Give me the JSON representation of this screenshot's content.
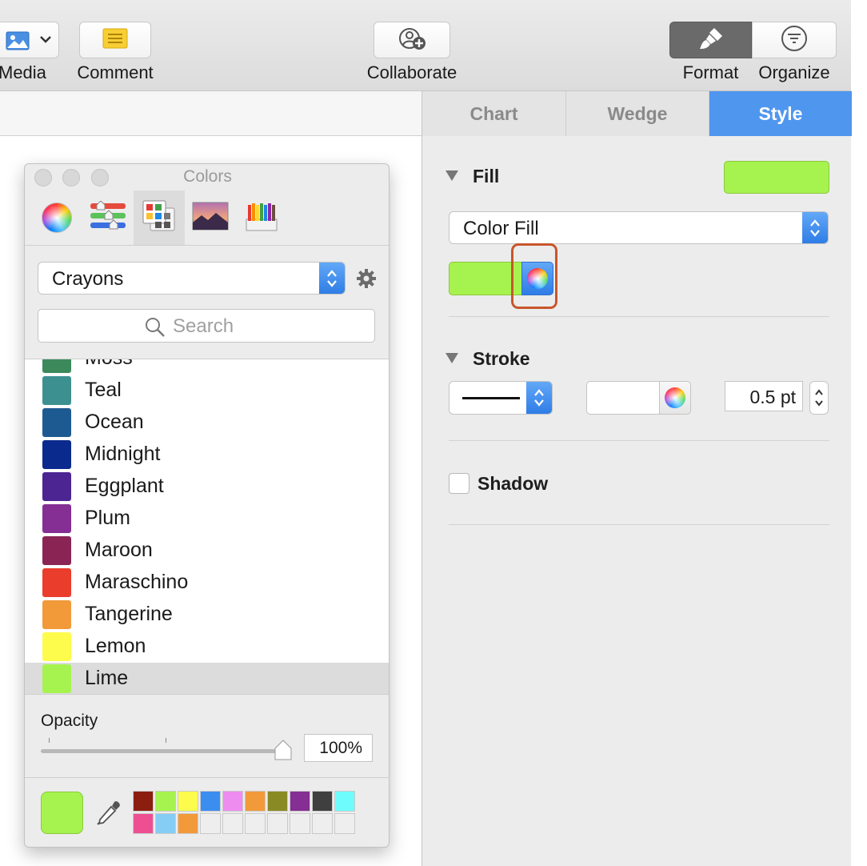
{
  "toolbar": {
    "media_label": "Media",
    "comment_label": "Comment",
    "collaborate_label": "Collaborate",
    "format_label": "Format",
    "organize_label": "Organize"
  },
  "inspector": {
    "tabs": [
      {
        "label": "Chart",
        "active": false
      },
      {
        "label": "Wedge",
        "active": false
      },
      {
        "label": "Style",
        "active": true
      }
    ],
    "fill": {
      "section_label": "Fill",
      "color": "#a6f34f",
      "type_value": "Color Fill"
    },
    "stroke": {
      "section_label": "Stroke",
      "width_value": "0.5 pt"
    },
    "shadow": {
      "label": "Shadow",
      "checked": false
    },
    "highlight_color": "#c8562a",
    "accent_color": "#4f96ef"
  },
  "colors_panel": {
    "title": "Colors",
    "palette_value": "Crayons",
    "search_placeholder": "Search",
    "crayons": [
      {
        "name": "Moss",
        "color": "#3c8a5c"
      },
      {
        "name": "Teal",
        "color": "#3c9190"
      },
      {
        "name": "Ocean",
        "color": "#1e5a92"
      },
      {
        "name": "Midnight",
        "color": "#0b2a8d"
      },
      {
        "name": "Eggplant",
        "color": "#4c2593"
      },
      {
        "name": "Plum",
        "color": "#852e94"
      },
      {
        "name": "Maroon",
        "color": "#8a2455"
      },
      {
        "name": "Maraschino",
        "color": "#ea3d2b"
      },
      {
        "name": "Tangerine",
        "color": "#f29a3a"
      },
      {
        "name": "Lemon",
        "color": "#fdfb4c"
      },
      {
        "name": "Lime",
        "color": "#a6f34f"
      }
    ],
    "selected_crayon": "Lime",
    "opacity_label": "Opacity",
    "opacity_value": "100%",
    "opacity_fraction": 1.0,
    "current_color": "#a6f34f",
    "saved_swatches_row1": [
      "#8b1e0f",
      "#a6f34f",
      "#fdfb4c",
      "#3b8ef0",
      "#ef8cf0",
      "#f29a3a",
      "#8a8a25",
      "#852e94",
      "#3f3f3f",
      "#6ffcfc"
    ],
    "saved_swatches_row2": [
      "#ee4f93",
      "#85cdf5",
      "#f29a3a",
      "",
      "",
      "",
      "",
      "",
      "",
      ""
    ]
  }
}
